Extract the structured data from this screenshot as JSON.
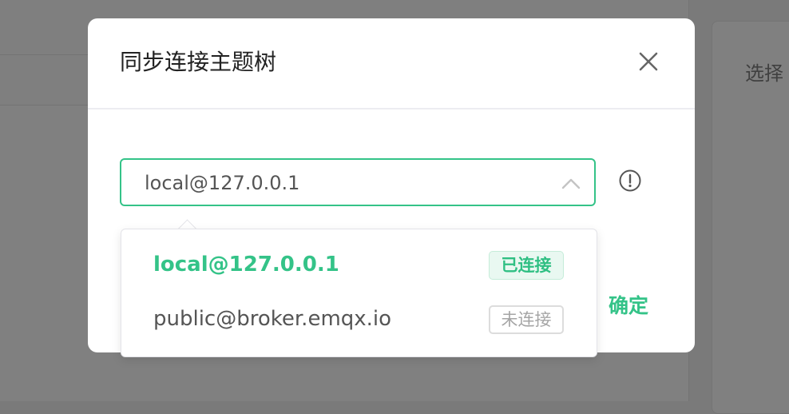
{
  "background": {
    "right_panel_title": "选择"
  },
  "dialog": {
    "title": "同步连接主题树",
    "close_icon": "close-icon",
    "select": {
      "value": "local@127.0.0.1",
      "arrow_icon": "chevron-up-icon"
    },
    "info_icon": "info-circle-icon",
    "confirm_label": "确定"
  },
  "dropdown": {
    "options": [
      {
        "label": "local@127.0.0.1",
        "status": "已连接",
        "selected": true
      },
      {
        "label": "public@broker.emqx.io",
        "status": "未连接",
        "selected": false
      }
    ]
  },
  "colors": {
    "accent": "#34c388",
    "connected_badge_bg": "#e9f8f1",
    "overlay": "#808080"
  }
}
